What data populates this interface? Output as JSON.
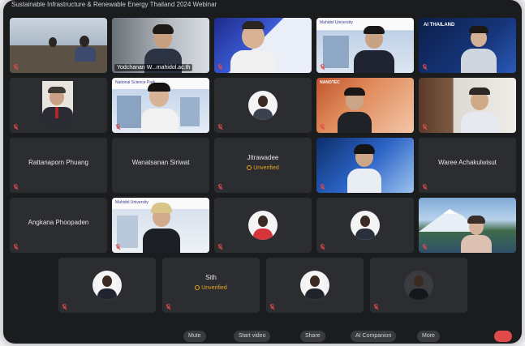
{
  "window": {
    "topbar_text": "Sustainable Infrastructure & Renewable Energy Thailand 2024 Webinar"
  },
  "tiles": [
    {
      "id": "r1c1",
      "name": "",
      "unverified": false
    },
    {
      "id": "r1c2",
      "name": "Yodchanan W...mahidol.ac.th",
      "unverified": false,
      "active": true
    },
    {
      "id": "r1c3",
      "name": "",
      "unverified": false
    },
    {
      "id": "r1c4",
      "name": "",
      "unverified": false
    },
    {
      "id": "r1c5",
      "name": "",
      "unverified": false
    },
    {
      "id": "r2c1",
      "name": "",
      "unverified": false
    },
    {
      "id": "r2c2",
      "name": "",
      "unverified": false
    },
    {
      "id": "r2c3",
      "name": "",
      "unverified": false
    },
    {
      "id": "r2c4",
      "name": "",
      "unverified": false
    },
    {
      "id": "r2c5",
      "name": "",
      "unverified": false
    },
    {
      "id": "r3c1",
      "name": "Rattanaporn Phuang",
      "unverified": false
    },
    {
      "id": "r3c2",
      "name": "Wanatsanan Siriwat",
      "unverified": false
    },
    {
      "id": "r3c3",
      "name": "Jitrawadee",
      "unverified": true
    },
    {
      "id": "r3c4",
      "name": "",
      "unverified": false
    },
    {
      "id": "r3c5",
      "name": "Waree Achakulwisut",
      "unverified": false
    },
    {
      "id": "r4c1",
      "name": "Angkana Phoopaden",
      "unverified": false
    },
    {
      "id": "r4c2",
      "name": "",
      "unverified": false
    },
    {
      "id": "r4c3",
      "name": "",
      "unverified": false
    },
    {
      "id": "r4c4",
      "name": "",
      "unverified": false
    },
    {
      "id": "r4c5",
      "name": "",
      "unverified": false
    },
    {
      "id": "r5c1",
      "name": "",
      "unverified": false
    },
    {
      "id": "r5c2",
      "name": "Sith",
      "unverified": true
    },
    {
      "id": "r5c3",
      "name": "",
      "unverified": false
    },
    {
      "id": "r5c4",
      "name": "",
      "unverified": false
    }
  ],
  "labels": {
    "unverified": "Unverified",
    "slide_org": "Mahidol University",
    "slide_org2": "National Science Park",
    "ai_thailand": "AI THAILAND",
    "nanotec": "NANOTEC"
  },
  "toolbar": {
    "mute": "Mute",
    "start_video": "Start video",
    "share": "Share",
    "ai_companion": "AI Companion",
    "more": "More"
  },
  "colors": {
    "accent": "#2f7ff0",
    "unverified": "#e7a51f",
    "tile_bg": "#2c2d30",
    "end": "#e04a4a"
  }
}
